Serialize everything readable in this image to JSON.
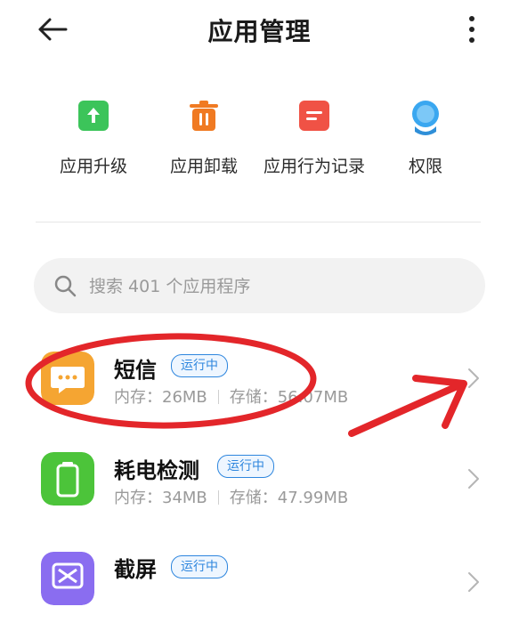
{
  "header": {
    "title": "应用管理",
    "back_icon": "back-arrow-icon",
    "more_icon": "more-vertical-icon"
  },
  "actions": [
    {
      "label": "应用升级",
      "icon": "upgrade-icon",
      "color": "#3cc45a"
    },
    {
      "label": "应用卸载",
      "icon": "trash-icon",
      "color": "#f07a22"
    },
    {
      "label": "应用行为记录",
      "icon": "record-icon",
      "color": "#f05245"
    },
    {
      "label": "权限",
      "icon": "permission-icon",
      "color": "#3aa7f0"
    }
  ],
  "search": {
    "placeholder": "搜索 401 个应用程序"
  },
  "apps": [
    {
      "name": "短信",
      "status": "运行中",
      "memory": "内存：26MB",
      "storage": "存储：56.07MB",
      "icon": "sms-icon",
      "color": "#f5a532"
    },
    {
      "name": "耗电检测",
      "status": "运行中",
      "memory": "内存：34MB",
      "storage": "存储：47.99MB",
      "icon": "battery-icon",
      "color": "#4cc43a"
    },
    {
      "name": "截屏",
      "status": "运行中",
      "icon": "screenshot-icon",
      "color": "#8a6df0"
    }
  ]
}
